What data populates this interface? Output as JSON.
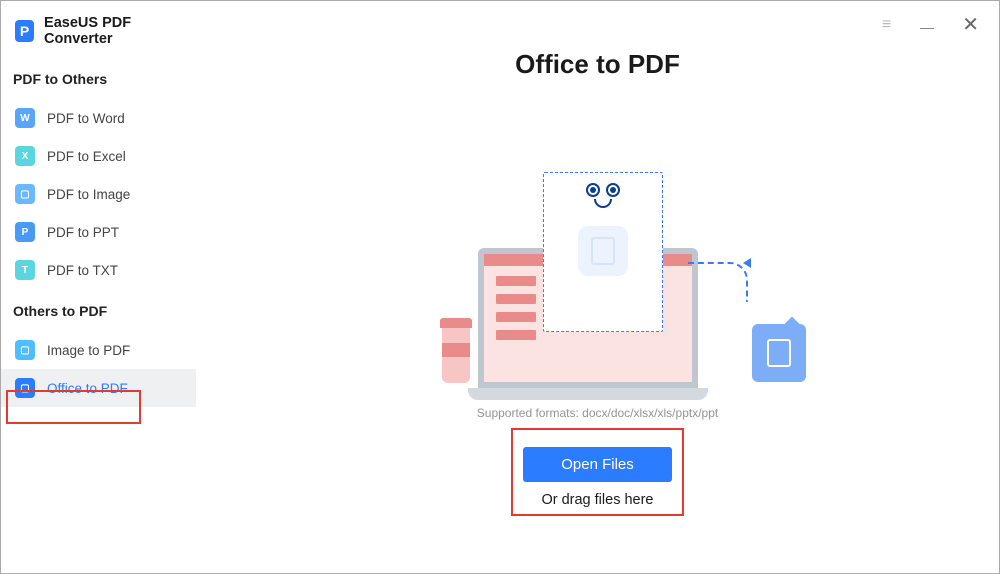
{
  "app": {
    "title": "EaseUS PDF Converter",
    "logoLetter": "P"
  },
  "sidebar": {
    "section1": "PDF to Others",
    "section2": "Others to PDF",
    "items1": [
      {
        "label": "PDF to Word",
        "iconLetter": "W",
        "iconClass": "icon-w"
      },
      {
        "label": "PDF to Excel",
        "iconLetter": "X",
        "iconClass": "icon-x"
      },
      {
        "label": "PDF to Image",
        "iconLetter": "▢",
        "iconClass": "icon-i"
      },
      {
        "label": "PDF to PPT",
        "iconLetter": "P",
        "iconClass": "icon-p"
      },
      {
        "label": "PDF to TXT",
        "iconLetter": "T",
        "iconClass": "icon-t"
      }
    ],
    "items2": [
      {
        "label": "Image to PDF",
        "iconLetter": "▢",
        "iconClass": "icon-img"
      },
      {
        "label": "Office to PDF",
        "iconLetter": "▢",
        "iconClass": "icon-o"
      }
    ]
  },
  "main": {
    "pageTitle": "Office to PDF",
    "supportedFormats": "Supported formats: docx/doc/xlsx/xls/pptx/ppt",
    "openButton": "Open Files",
    "dragText": "Or drag files here"
  }
}
